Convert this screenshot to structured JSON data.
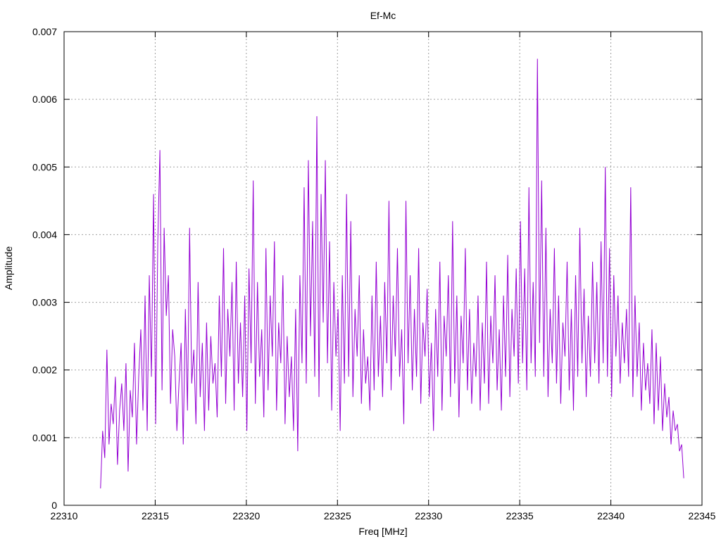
{
  "chart_data": {
    "type": "line",
    "title": "Ef-Mc",
    "xlabel": "Freq [MHz]",
    "ylabel": "Amplitude",
    "xlim": [
      22310,
      22345
    ],
    "ylim": [
      0,
      0.007
    ],
    "x_ticks": [
      "22310",
      "22315",
      "22320",
      "22325",
      "22330",
      "22335",
      "22340",
      "22345"
    ],
    "y_ticks": [
      "0",
      "0.001",
      "0.002",
      "0.003",
      "0.004",
      "0.005",
      "0.006",
      "0.007"
    ],
    "grid": true,
    "legend": "none",
    "line_color": "#9400d3",
    "series": [
      {
        "x_start": 22312.0,
        "x_end": 22344.0,
        "y": [
          0.00025,
          0.0011,
          0.0007,
          0.0023,
          0.0009,
          0.0015,
          0.0012,
          0.0019,
          0.0006,
          0.0014,
          0.0018,
          0.0011,
          0.0021,
          0.0005,
          0.0017,
          0.0013,
          0.0024,
          0.0009,
          0.0019,
          0.0026,
          0.0014,
          0.0031,
          0.0011,
          0.0034,
          0.0019,
          0.0046,
          0.0012,
          0.0039,
          0.00525,
          0.0017,
          0.0041,
          0.0028,
          0.0034,
          0.0015,
          0.0026,
          0.0022,
          0.0011,
          0.0018,
          0.0024,
          0.0009,
          0.0029,
          0.0014,
          0.0041,
          0.0018,
          0.0023,
          0.0012,
          0.0033,
          0.0016,
          0.0024,
          0.0011,
          0.0027,
          0.0014,
          0.0025,
          0.0018,
          0.0021,
          0.0013,
          0.0031,
          0.0019,
          0.0038,
          0.0015,
          0.0029,
          0.0022,
          0.0033,
          0.0014,
          0.0036,
          0.0018,
          0.0027,
          0.0016,
          0.0031,
          0.0011,
          0.0035,
          0.0021,
          0.0048,
          0.0015,
          0.0033,
          0.0019,
          0.0026,
          0.0013,
          0.0038,
          0.0017,
          0.0031,
          0.0022,
          0.0039,
          0.0014,
          0.0027,
          0.0021,
          0.0034,
          0.0012,
          0.0025,
          0.0016,
          0.0022,
          0.0011,
          0.0029,
          0.0008,
          0.0034,
          0.0021,
          0.0047,
          0.0018,
          0.0051,
          0.0025,
          0.0042,
          0.0019,
          0.00575,
          0.0016,
          0.0046,
          0.0027,
          0.0051,
          0.0021,
          0.0039,
          0.0014,
          0.0033,
          0.0022,
          0.0029,
          0.0011,
          0.0034,
          0.0018,
          0.0046,
          0.0019,
          0.0042,
          0.0016,
          0.0029,
          0.0022,
          0.0034,
          0.0015,
          0.0026,
          0.0018,
          0.0022,
          0.0014,
          0.0031,
          0.0017,
          0.0036,
          0.0019,
          0.0028,
          0.0016,
          0.0033,
          0.0021,
          0.0045,
          0.0017,
          0.0031,
          0.0022,
          0.0038,
          0.0019,
          0.0026,
          0.0012,
          0.0045,
          0.0021,
          0.0034,
          0.0017,
          0.0029,
          0.0019,
          0.0038,
          0.0015,
          0.0027,
          0.0022,
          0.0032,
          0.0016,
          0.0024,
          0.0011,
          0.0029,
          0.0019,
          0.0036,
          0.0014,
          0.0028,
          0.0022,
          0.0034,
          0.0016,
          0.0042,
          0.0018,
          0.0031,
          0.0013,
          0.0028,
          0.0021,
          0.0038,
          0.0017,
          0.0029,
          0.0015,
          0.0024,
          0.0019,
          0.0031,
          0.0014,
          0.0027,
          0.0018,
          0.0036,
          0.0015,
          0.0028,
          0.0021,
          0.0034,
          0.0017,
          0.0026,
          0.0014,
          0.0031,
          0.0019,
          0.0037,
          0.0016,
          0.0029,
          0.0022,
          0.0035,
          0.0018,
          0.0042,
          0.0021,
          0.0035,
          0.0017,
          0.0047,
          0.0021,
          0.0033,
          0.0019,
          0.0066,
          0.0024,
          0.0048,
          0.0019,
          0.0041,
          0.0016,
          0.0029,
          0.0021,
          0.0038,
          0.0018,
          0.0031,
          0.0015,
          0.0027,
          0.0022,
          0.0036,
          0.0017,
          0.0029,
          0.0014,
          0.0034,
          0.0019,
          0.0041,
          0.0021,
          0.0032,
          0.0016,
          0.0028,
          0.0019,
          0.0036,
          0.0021,
          0.0033,
          0.0018,
          0.0039,
          0.0021,
          0.005,
          0.0019,
          0.0038,
          0.0016,
          0.0034,
          0.0022,
          0.0031,
          0.0018,
          0.0027,
          0.0021,
          0.0029,
          0.0019,
          0.0047,
          0.0016,
          0.0031,
          0.0019,
          0.0027,
          0.0014,
          0.0024,
          0.0017,
          0.0021,
          0.0015,
          0.0026,
          0.0012,
          0.0024,
          0.0014,
          0.0022,
          0.0011,
          0.0018,
          0.0013,
          0.0016,
          0.0009,
          0.0014,
          0.0011,
          0.0012,
          0.0008,
          0.0009,
          0.0004
        ]
      }
    ]
  }
}
